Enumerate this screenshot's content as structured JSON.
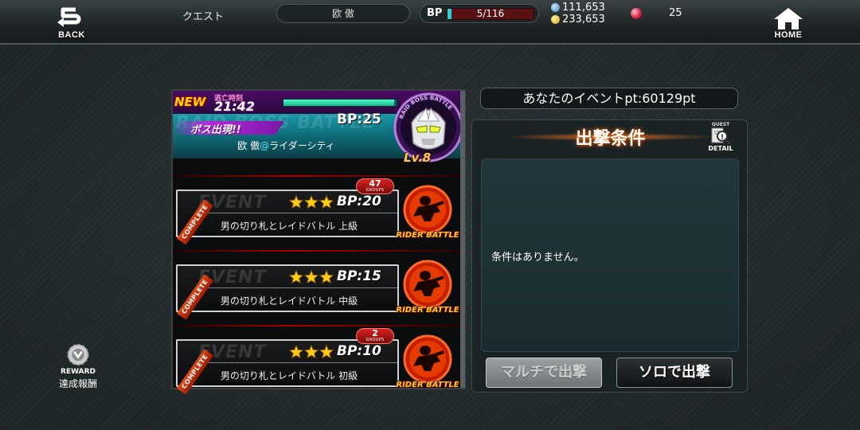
{
  "top_bar": {
    "back_label": "BACK",
    "home_label": "HOME",
    "screen_title": "クエスト",
    "player_name": "欧 傲",
    "bp_label": "BP",
    "bp_value": "5/116",
    "bp_fraction": 0.043,
    "currency_1": "111,653",
    "currency_2": "233,653",
    "gems": "25"
  },
  "raid_boss": {
    "watermark": "RAID BOSS BATTLE",
    "new_tag": "NEW",
    "escape_label": "逃亡時刻",
    "timer": "21:42",
    "time_remaining_fraction": 0.98,
    "appear_label": "ボス出現!!",
    "bp_cost": "BP:25",
    "owner": "欧 傲",
    "owner_at": "@",
    "location": "ライダーシティ",
    "badge_text": "RAID BOSS BATTLE",
    "level": "Lv.8"
  },
  "events": [
    {
      "watermark": "EVENT",
      "stars": 3,
      "bp": "BP:20",
      "name": "男の切り札とレイドバトル 上級",
      "complete": "COMPLETE",
      "groups_count": "47",
      "groups_label": "GROUPS",
      "action_label": "RIDER BATTLE"
    },
    {
      "watermark": "EVENT",
      "stars": 3,
      "bp": "BP:15",
      "name": "男の切り札とレイドバトル 中級",
      "complete": "COMPLETE",
      "groups_count": "",
      "groups_label": "",
      "action_label": "RIDER BATTLE"
    },
    {
      "watermark": "EVENT",
      "stars": 3,
      "bp": "BP:10",
      "name": "男の切り札とレイドバトル 初級",
      "complete": "COMPLETE",
      "groups_count": "2",
      "groups_label": "GROUPS",
      "action_label": "RIDER BATTLE"
    }
  ],
  "right_panel": {
    "event_points": "あなたのイベントpt:60129pt",
    "conditions_title": "出撃条件",
    "detail_top": "QUEST",
    "detail_label": "DETAIL",
    "conditions_text": "条件はありません。",
    "multi_button": "マルチで出撃",
    "solo_button": "ソロで出撃"
  },
  "reward": {
    "en_label": "REWARD",
    "jp_label": "達成報酬"
  },
  "colors": {
    "background": "#232b2d",
    "accent_cyan": "#2fd0de",
    "accent_red": "#b00000",
    "accent_gold": "#ffde00"
  }
}
